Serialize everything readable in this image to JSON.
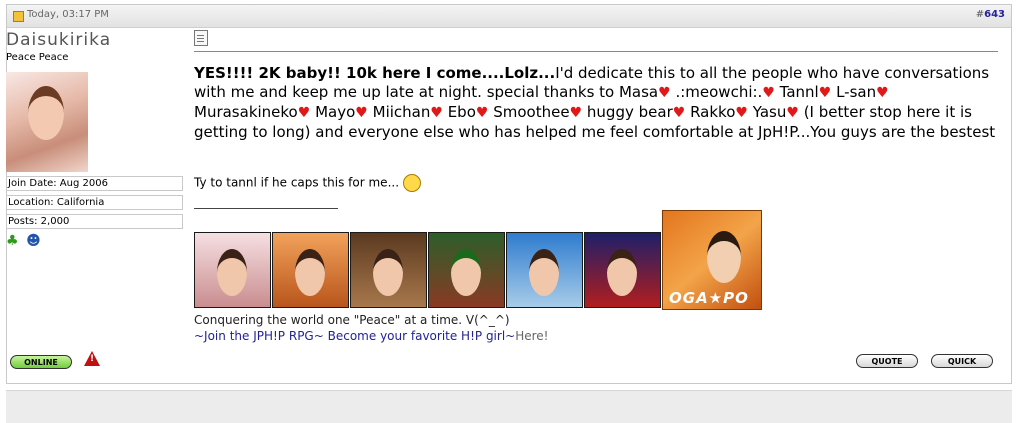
{
  "post": {
    "date": "Today, 03:17 PM",
    "number_prefix": "#",
    "number": "643"
  },
  "user": {
    "name": "Daisukirika",
    "title": "Peace Peace",
    "join_date": "Join Date: Aug 2006",
    "location": "Location: California",
    "posts": "Posts: 2,000",
    "icons": [
      "clover-icon",
      "user-icon"
    ]
  },
  "message": {
    "headline": "YES!!!! 2K baby!! 10k here I come....Lolz...",
    "p1": "I'd dedicate this to all the people who have conversations with me and keep me up late at night. special thanks to Masa",
    "names": [
      ".:meowchi:.",
      "Tannl",
      "L-san",
      "Murasakineko",
      "Mayo",
      "Miichan",
      "Ebo",
      "Smoothee",
      "huggy bear",
      "Rakko",
      "Yasu"
    ],
    "p2": "(I better stop here it is getting to long) and everyone else who has helped me feel comfortable at JpH!P...You guys are the bestest",
    "ty": "Ty to tannl if he caps this for me..."
  },
  "signature": {
    "banner_logo": "OGA★PO",
    "text": "Conquering the world one \"Peace\" at a time. V(^_^)",
    "link1": "~Join the JPH!P RPG~",
    "link2": "Become your favorite H!P girl~",
    "link3": "Here!"
  },
  "buttons": {
    "online": "ONLINE",
    "quote": "QUOTE",
    "quick": "QUICK"
  },
  "colors": {
    "link": "#22229c",
    "heart": "#e01818",
    "online_green": "#6fcf3c"
  }
}
